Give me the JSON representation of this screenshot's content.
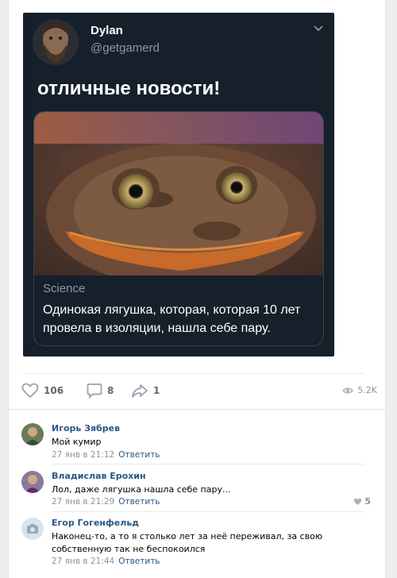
{
  "tweet": {
    "author_name": "Dylan",
    "author_handle": "@getgamerd",
    "text": "отличные новости!",
    "card_source": "Science",
    "card_headline": "Одинокая лягушка, которая, которая 10 лет провела в изоляции, нашла себе пару."
  },
  "actions": {
    "likes": "106",
    "comments": "8",
    "shares": "1",
    "views": "5.2K"
  },
  "comments": [
    {
      "author": "Игорь Зябрев",
      "text": "Мой кумир",
      "date": "27 янв в 21:12",
      "reply": "Ответить",
      "likes": ""
    },
    {
      "author": "Владислав Ерохин",
      "text": "Лол, даже лягушка нашла себе пару...",
      "date": "27 янв в 21:29",
      "reply": "Ответить",
      "likes": "5"
    },
    {
      "author": "Егор Гогенфельд",
      "text": "Наконец-то, а то я столько лет за неё переживал, за свою собственную так не беспокоился",
      "date": "27 янв в 21:44",
      "reply": "Ответить",
      "likes": ""
    }
  ],
  "colors": {
    "link": "#2a5885",
    "tweet_bg": "#15202b",
    "muted": "#939393"
  },
  "icons": [
    "chevron-down-icon",
    "heart-icon",
    "comment-icon",
    "share-icon",
    "eye-icon",
    "camera-icon"
  ]
}
